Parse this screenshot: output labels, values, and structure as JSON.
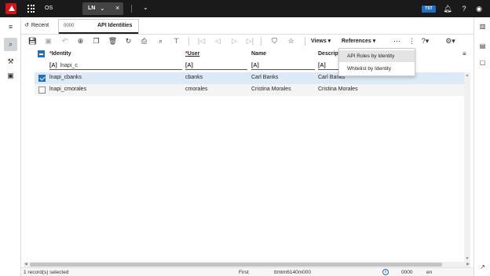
{
  "topbar": {
    "workspace": "OS",
    "app_tab": "LN",
    "env_badge": "TST",
    "env_color": "#1f6fc5",
    "icons": [
      "notification-icon",
      "help-icon",
      "user-icon"
    ]
  },
  "tabs": {
    "recent_label": "Recent",
    "active_tab_number": "0000",
    "active_tab_title": "API Identities"
  },
  "toolbar": {
    "views_label": "Views",
    "references_label": "References"
  },
  "grid": {
    "columns": [
      {
        "label": "Identity",
        "required": true
      },
      {
        "label": "User",
        "required": true
      },
      {
        "label": "Name",
        "required": false
      },
      {
        "label": "Descripti",
        "required": false
      }
    ],
    "filters": [
      {
        "badge": "[A]",
        "value": "lnapi_c"
      },
      {
        "badge": "[A]",
        "value": ""
      },
      {
        "badge": "[A]",
        "value": ""
      },
      {
        "badge": "[A]",
        "value": ""
      }
    ],
    "rows": [
      {
        "identity": "lnapi_cbanks",
        "user": "cbanks",
        "name": "Carl Banks",
        "description": "Carl Banks",
        "selected": true
      },
      {
        "identity": "lnapi_cmorales",
        "user": "cmorales",
        "name": "Cristina Morales",
        "description": "Cristina Morales",
        "selected": false
      }
    ]
  },
  "references_menu": {
    "items": [
      "API Roles by Identity",
      "Whitelist by Identity"
    ]
  },
  "status": {
    "selection": "1 record(s) selected",
    "position": "First",
    "session": "ttmtm6140m000",
    "company": "0000",
    "language": "en"
  },
  "colors": {
    "accent": "#1f6fc5",
    "brand": "#da1217",
    "selected_row": "#dce9f7"
  }
}
